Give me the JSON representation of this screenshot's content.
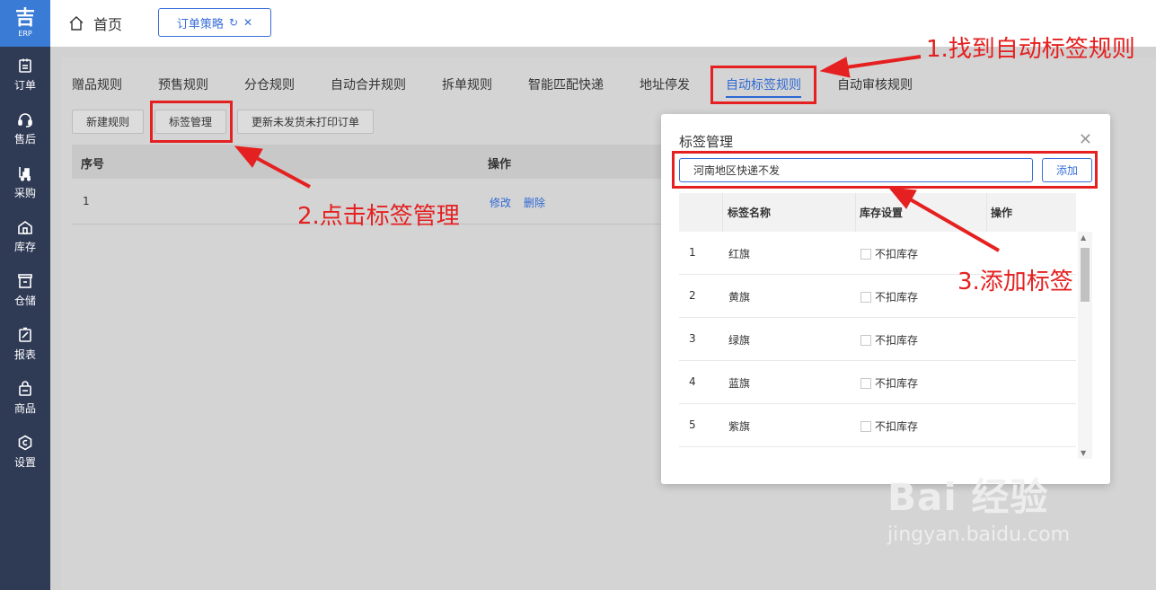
{
  "logo": {
    "line1": "吉",
    "line2": "ERP"
  },
  "sidebar": {
    "items": [
      {
        "label": "订单",
        "icon": "clipboard-icon"
      },
      {
        "label": "售后",
        "icon": "headset-icon"
      },
      {
        "label": "采购",
        "icon": "cart-icon"
      },
      {
        "label": "库存",
        "icon": "warehouse-icon"
      },
      {
        "label": "仓储",
        "icon": "storage-icon"
      },
      {
        "label": "报表",
        "icon": "report-icon"
      },
      {
        "label": "商品",
        "icon": "bag-icon"
      },
      {
        "label": "设置",
        "icon": "gear-icon"
      }
    ]
  },
  "header": {
    "home_label": "首页",
    "open_tab": "订单策略"
  },
  "tabs": [
    "赠品规则",
    "预售规则",
    "分仓规则",
    "自动合并规则",
    "拆单规则",
    "智能匹配快递",
    "地址停发",
    "自动标签规则",
    "自动审核规则"
  ],
  "active_tab_index": 7,
  "toolbar": {
    "new_rule": "新建规则",
    "tag_manage": "标签管理",
    "update_unshipped": "更新未发货未打印订单"
  },
  "table": {
    "columns": [
      "序号",
      "操作"
    ],
    "rows": [
      {
        "index": "1",
        "edit": "修改",
        "delete": "删除"
      }
    ]
  },
  "dialog": {
    "title": "标签管理",
    "input_value": "河南地区快递不发",
    "add_button": "添加",
    "columns": [
      "标签名称",
      "库存设置",
      "操作"
    ],
    "rows": [
      {
        "index": "1",
        "name": "红旗",
        "stock": "不扣库存"
      },
      {
        "index": "2",
        "name": "黄旗",
        "stock": "不扣库存"
      },
      {
        "index": "3",
        "name": "绿旗",
        "stock": "不扣库存"
      },
      {
        "index": "4",
        "name": "蓝旗",
        "stock": "不扣库存"
      },
      {
        "index": "5",
        "name": "紫旗",
        "stock": "不扣库存"
      }
    ]
  },
  "annotations": {
    "step1": "1.找到自动标签规则",
    "step2": "2.点击标签管理",
    "step3": "3.添加标签",
    "color": "#e52020"
  },
  "watermark": {
    "brand": "Bai 经验",
    "url": "jingyan.baidu.com"
  },
  "colors": {
    "accent": "#2f68d3",
    "sidebar": "#2f3a55",
    "logo_bg": "#3a7bd5"
  }
}
